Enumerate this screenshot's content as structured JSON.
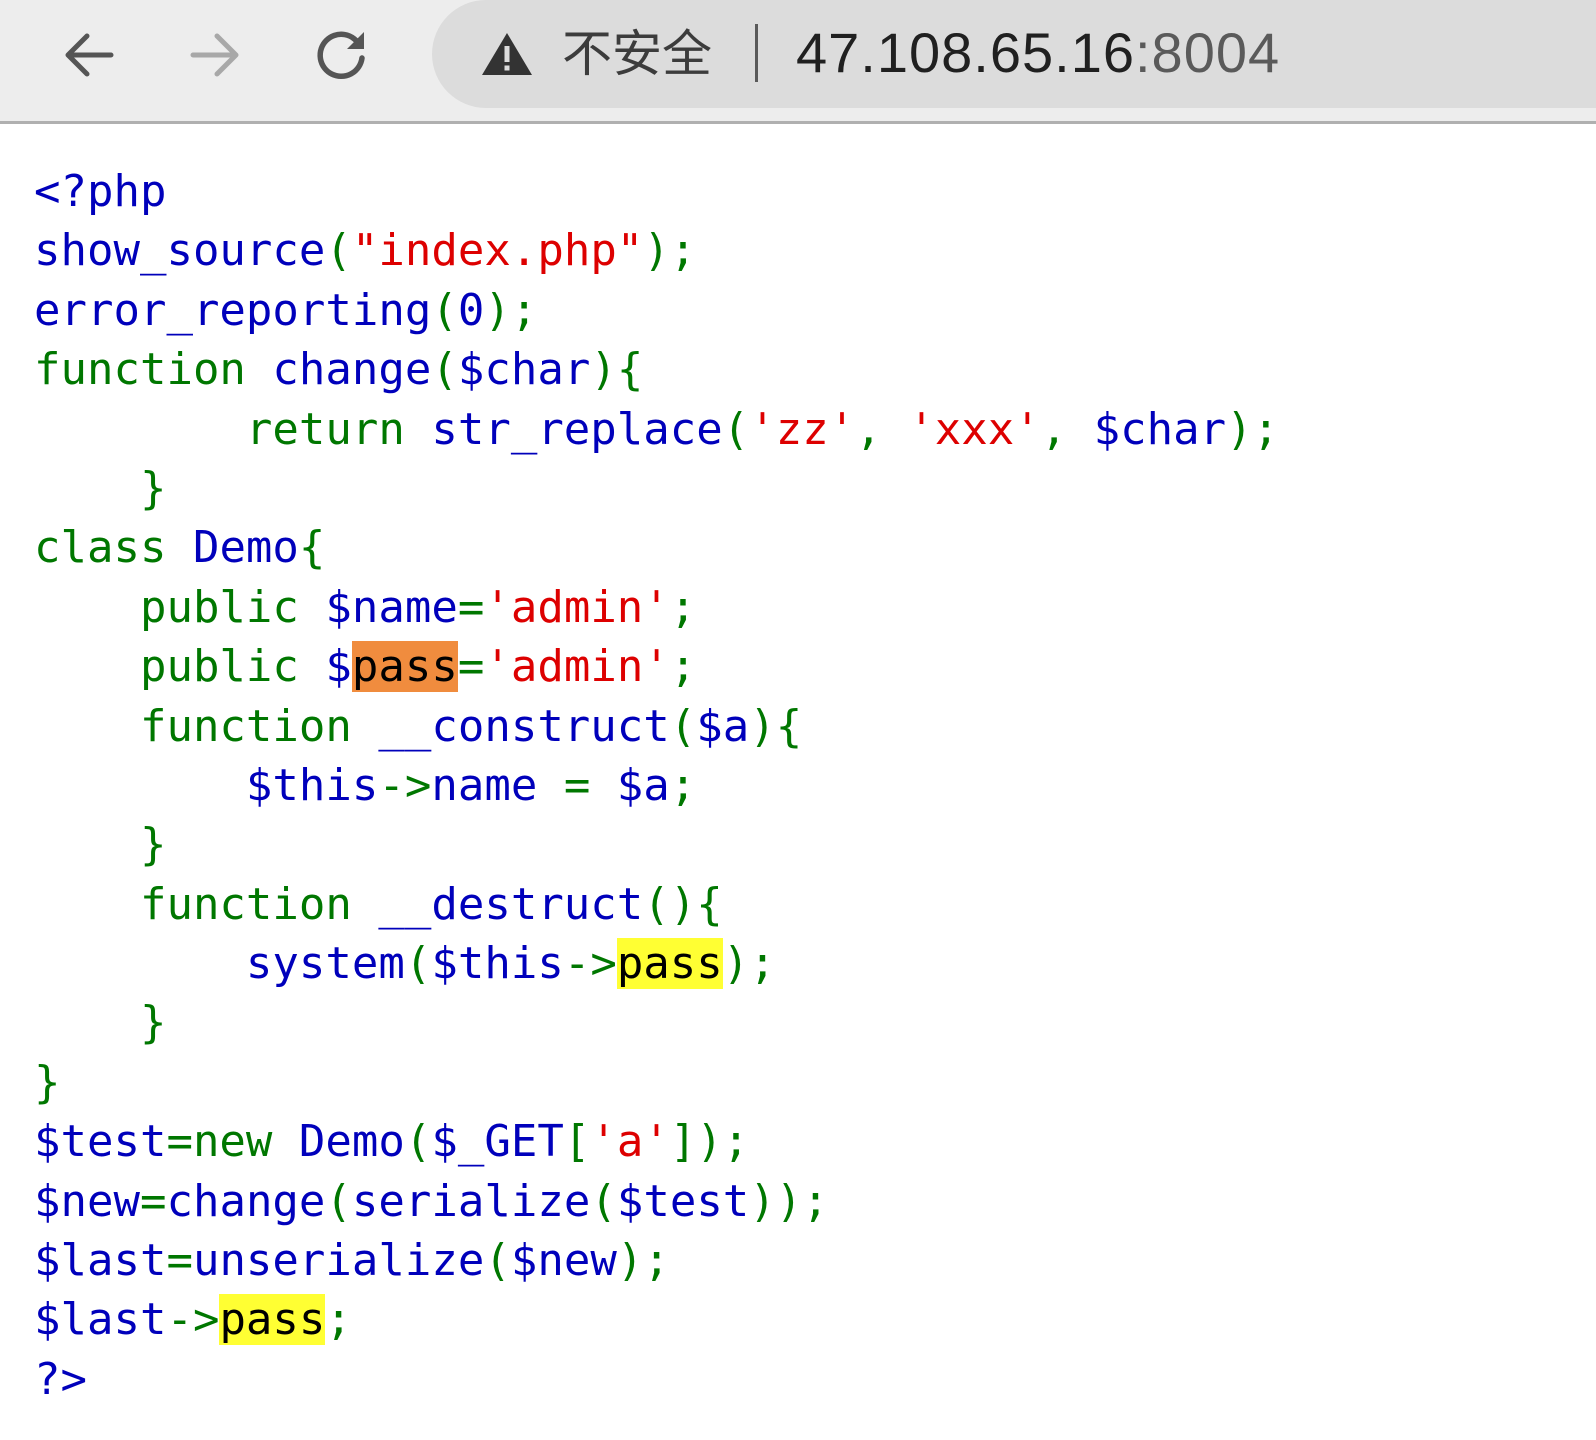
{
  "browser": {
    "security_label": "不安全",
    "url_host": "47.108.65.16",
    "url_port": ":8004"
  },
  "colors": {
    "default": "#0000bb",
    "keyword": "#007700",
    "string": "#dd0000",
    "find_current_match": "#f08c3e",
    "find_match": "#ffff33"
  },
  "code": {
    "lines": [
      [
        {
          "t": "<?php",
          "c": "default"
        }
      ],
      [
        {
          "t": "show_source",
          "c": "default"
        },
        {
          "t": "(",
          "c": "keyword"
        },
        {
          "t": "\"index.php\"",
          "c": "string"
        },
        {
          "t": ");",
          "c": "keyword"
        }
      ],
      [
        {
          "t": "error_reporting",
          "c": "default"
        },
        {
          "t": "(",
          "c": "keyword"
        },
        {
          "t": "0",
          "c": "default"
        },
        {
          "t": ");",
          "c": "keyword"
        }
      ],
      [
        {
          "t": "function ",
          "c": "keyword"
        },
        {
          "t": "change",
          "c": "default"
        },
        {
          "t": "(",
          "c": "keyword"
        },
        {
          "t": "$char",
          "c": "default"
        },
        {
          "t": "){",
          "c": "keyword"
        }
      ],
      [
        {
          "t": "        return ",
          "c": "keyword"
        },
        {
          "t": "str_replace",
          "c": "default"
        },
        {
          "t": "(",
          "c": "keyword"
        },
        {
          "t": "'zz'",
          "c": "string"
        },
        {
          "t": ", ",
          "c": "keyword"
        },
        {
          "t": "'xxx'",
          "c": "string"
        },
        {
          "t": ", ",
          "c": "keyword"
        },
        {
          "t": "$char",
          "c": "default"
        },
        {
          "t": ");",
          "c": "keyword"
        }
      ],
      [
        {
          "t": "    }",
          "c": "keyword"
        }
      ],
      [
        {
          "t": "class ",
          "c": "keyword"
        },
        {
          "t": "Demo",
          "c": "default"
        },
        {
          "t": "{",
          "c": "keyword"
        }
      ],
      [
        {
          "t": "    public ",
          "c": "keyword"
        },
        {
          "t": "$name",
          "c": "default"
        },
        {
          "t": "=",
          "c": "keyword"
        },
        {
          "t": "'admin'",
          "c": "string"
        },
        {
          "t": ";",
          "c": "keyword"
        }
      ],
      [
        {
          "t": "    public ",
          "c": "keyword"
        },
        {
          "t": "$",
          "c": "default"
        },
        {
          "t": "pass",
          "c": "default",
          "hl": "orange"
        },
        {
          "t": "=",
          "c": "keyword"
        },
        {
          "t": "'admin'",
          "c": "string"
        },
        {
          "t": ";",
          "c": "keyword"
        }
      ],
      [
        {
          "t": "    function ",
          "c": "keyword"
        },
        {
          "t": "__construct",
          "c": "default"
        },
        {
          "t": "(",
          "c": "keyword"
        },
        {
          "t": "$a",
          "c": "default"
        },
        {
          "t": "){",
          "c": "keyword"
        }
      ],
      [
        {
          "t": "        $this",
          "c": "default"
        },
        {
          "t": "->",
          "c": "keyword"
        },
        {
          "t": "name ",
          "c": "default"
        },
        {
          "t": "= ",
          "c": "keyword"
        },
        {
          "t": "$a",
          "c": "default"
        },
        {
          "t": ";",
          "c": "keyword"
        }
      ],
      [
        {
          "t": "    }",
          "c": "keyword"
        }
      ],
      [
        {
          "t": "    function ",
          "c": "keyword"
        },
        {
          "t": "__destruct",
          "c": "default"
        },
        {
          "t": "(){",
          "c": "keyword"
        }
      ],
      [
        {
          "t": "        system",
          "c": "default"
        },
        {
          "t": "(",
          "c": "keyword"
        },
        {
          "t": "$this",
          "c": "default"
        },
        {
          "t": "->",
          "c": "keyword"
        },
        {
          "t": "pass",
          "c": "default",
          "hl": "yellow"
        },
        {
          "t": ");",
          "c": "keyword"
        }
      ],
      [
        {
          "t": "    }",
          "c": "keyword"
        }
      ],
      [
        {
          "t": "}",
          "c": "keyword"
        }
      ],
      [
        {
          "t": "$test",
          "c": "default"
        },
        {
          "t": "=new ",
          "c": "keyword"
        },
        {
          "t": "Demo",
          "c": "default"
        },
        {
          "t": "(",
          "c": "keyword"
        },
        {
          "t": "$_GET",
          "c": "default"
        },
        {
          "t": "[",
          "c": "keyword"
        },
        {
          "t": "'a'",
          "c": "string"
        },
        {
          "t": "]);",
          "c": "keyword"
        }
      ],
      [
        {
          "t": "$new",
          "c": "default"
        },
        {
          "t": "=",
          "c": "keyword"
        },
        {
          "t": "change",
          "c": "default"
        },
        {
          "t": "(",
          "c": "keyword"
        },
        {
          "t": "serialize",
          "c": "default"
        },
        {
          "t": "(",
          "c": "keyword"
        },
        {
          "t": "$test",
          "c": "default"
        },
        {
          "t": "));",
          "c": "keyword"
        }
      ],
      [
        {
          "t": "$last",
          "c": "default"
        },
        {
          "t": "=",
          "c": "keyword"
        },
        {
          "t": "unserialize",
          "c": "default"
        },
        {
          "t": "(",
          "c": "keyword"
        },
        {
          "t": "$new",
          "c": "default"
        },
        {
          "t": ");",
          "c": "keyword"
        }
      ],
      [
        {
          "t": "$last",
          "c": "default"
        },
        {
          "t": "->",
          "c": "keyword"
        },
        {
          "t": "pass",
          "c": "default",
          "hl": "yellow"
        },
        {
          "t": ";",
          "c": "keyword"
        }
      ],
      [
        {
          "t": "?>",
          "c": "default"
        }
      ]
    ]
  }
}
